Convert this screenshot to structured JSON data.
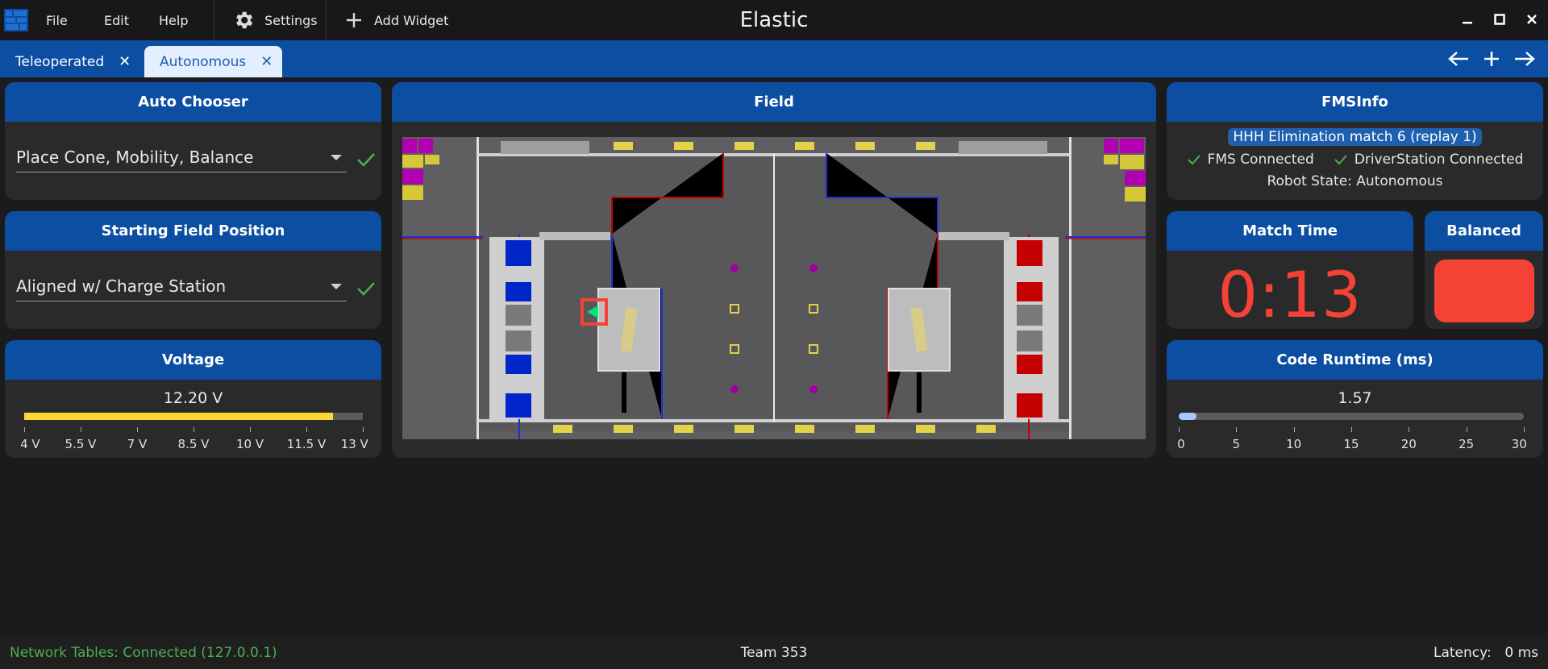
{
  "titlebar": {
    "app_title": "Elastic",
    "menu": {
      "file": "File",
      "edit": "Edit",
      "help": "Help",
      "settings": "Settings",
      "add_widget": "Add Widget"
    }
  },
  "tabs": [
    {
      "label": "Teleoperated",
      "active": false
    },
    {
      "label": "Autonomous",
      "active": true
    }
  ],
  "widgets": {
    "auto_chooser": {
      "title": "Auto Chooser",
      "selected": "Place Cone, Mobility, Balance"
    },
    "starting_position": {
      "title": "Starting Field Position",
      "selected": "Aligned w/ Charge Station"
    },
    "voltage": {
      "title": "Voltage",
      "value_text": "12.20 V",
      "value": 12.2,
      "min": 4,
      "max": 13,
      "ticks": [
        "4 V",
        "5.5 V",
        "7 V",
        "8.5 V",
        "10 V",
        "11.5 V",
        "13 V"
      ],
      "color": "#fdd835"
    },
    "field": {
      "title": "Field"
    },
    "fms_info": {
      "title": "FMSInfo",
      "match": "HHH Elimination match 6 (replay 1)",
      "fms_connected": "FMS Connected",
      "ds_connected": "DriverStation Connected",
      "robot_state": "Robot State: Autonomous"
    },
    "match_time": {
      "title": "Match Time",
      "value": "0:13",
      "color": "#f44336"
    },
    "balanced": {
      "title": "Balanced",
      "state": false,
      "color": "#f44336"
    },
    "code_runtime": {
      "title": "Code Runtime (ms)",
      "value_text": "1.57",
      "value": 1.57,
      "min": 0,
      "max": 30,
      "ticks": [
        "0",
        "5",
        "10",
        "15",
        "20",
        "25",
        "30"
      ],
      "color": "#a8c8ff"
    }
  },
  "statusbar": {
    "nt_status": "Network Tables: Connected (127.0.0.1)",
    "team": "Team 353",
    "latency_label": "Latency:",
    "latency_value": "0 ms"
  },
  "colors": {
    "accent": "#0b4ea2",
    "card": "#2a2a2b",
    "connected": "#4caf50",
    "alliance_blue": "#0026c9",
    "alliance_red": "#c40000"
  }
}
